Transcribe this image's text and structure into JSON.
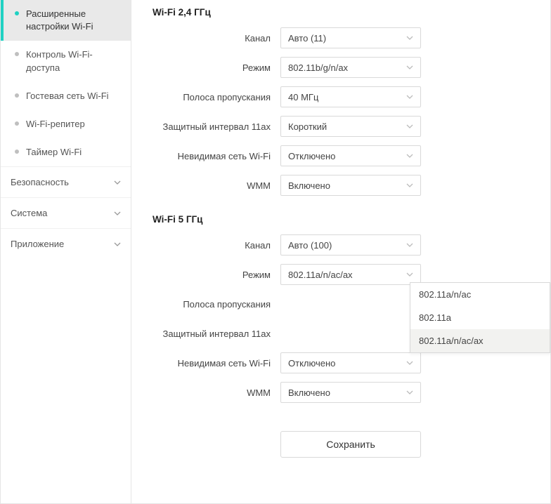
{
  "sidebar": {
    "sub_items": [
      {
        "label": "Расширенные настройки Wi-Fi",
        "active": true
      },
      {
        "label": "Контроль Wi-Fi-доступа",
        "active": false
      },
      {
        "label": "Гостевая сеть Wi-Fi",
        "active": false
      },
      {
        "label": "Wi-Fi-репитер",
        "active": false
      },
      {
        "label": "Таймер Wi-Fi",
        "active": false
      }
    ],
    "categories": [
      {
        "label": "Безопасность"
      },
      {
        "label": "Система"
      },
      {
        "label": "Приложение"
      }
    ]
  },
  "sections": {
    "wifi24": {
      "title": "Wi-Fi 2,4 ГГц",
      "rows": [
        {
          "label": "Канал",
          "value": "Авто (11)"
        },
        {
          "label": "Режим",
          "value": "802.11b/g/n/ax"
        },
        {
          "label": "Полоса пропускания",
          "value": "40 МГц"
        },
        {
          "label": "Защитный интервал 11ax",
          "value": "Короткий"
        },
        {
          "label": "Невидимая сеть Wi-Fi",
          "value": "Отключено"
        },
        {
          "label": "WMM",
          "value": "Включено"
        }
      ]
    },
    "wifi5": {
      "title": "Wi-Fi 5 ГГц",
      "rows": [
        {
          "label": "Канал",
          "value": "Авто (100)"
        },
        {
          "label": "Режим",
          "value": "802.11a/n/ac/ax"
        },
        {
          "label": "Полоса пропускания",
          "value": ""
        },
        {
          "label": "Защитный интервал 11ax",
          "value": ""
        },
        {
          "label": "Невидимая сеть Wi-Fi",
          "value": "Отключено"
        },
        {
          "label": "WMM",
          "value": "Включено"
        }
      ],
      "mode_dropdown": {
        "options": [
          {
            "label": "802.11a/n/ac",
            "highlight": false
          },
          {
            "label": "802.11a",
            "highlight": false
          },
          {
            "label": "802.11a/n/ac/ax",
            "highlight": true
          }
        ]
      }
    }
  },
  "save_label": "Сохранить"
}
